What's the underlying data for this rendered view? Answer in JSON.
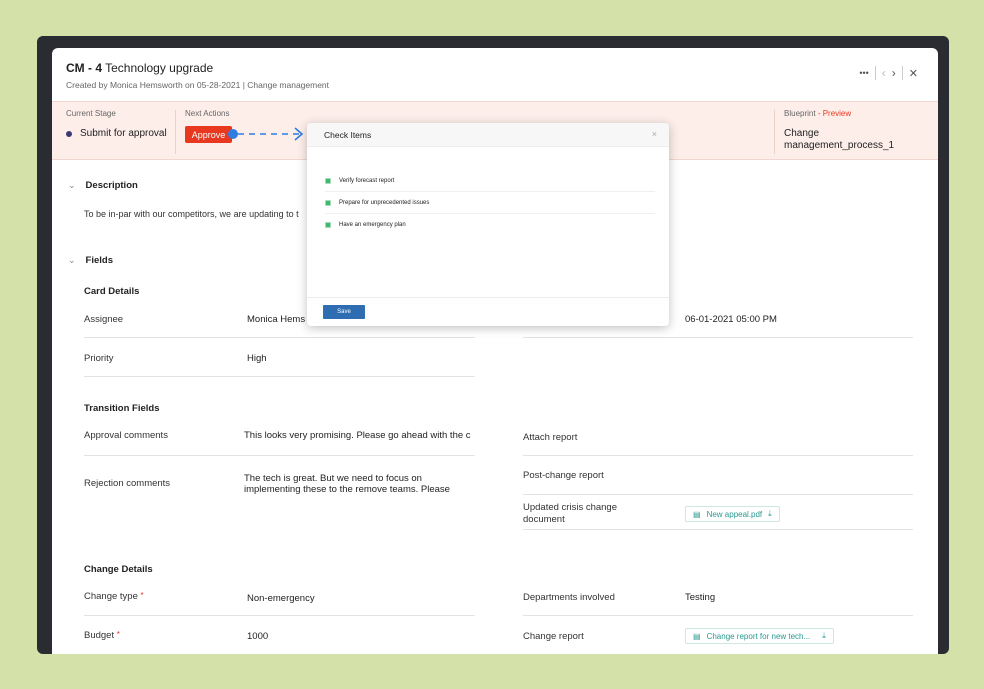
{
  "header": {
    "id": "CM - 4",
    "title": "Technology upgrade",
    "subtitle": "Created by Monica Hemsworth on 05-28-2021 | Change management",
    "more": "•••",
    "prev": "‹",
    "next": "›",
    "close": "✕"
  },
  "stage": {
    "current_label": "Current Stage",
    "current_value": "Submit for approval",
    "next_label": "Next Actions",
    "approve": "Approve",
    "blueprint_label": "Blueprint",
    "blueprint_preview": "- Preview",
    "blueprint_value": "Change management_process_1"
  },
  "description": {
    "heading": "Description",
    "text": "To be in-par with our competitors, we are updating to t"
  },
  "fields": {
    "heading": "Fields",
    "card_details": "Card Details",
    "assignee_label": "Assignee",
    "assignee_value": "Monica Hems",
    "due_value": "06-01-2021 05:00 PM",
    "priority_label": "Priority",
    "priority_value": "High",
    "transition_fields": "Transition Fields",
    "approval_label": "Approval comments",
    "approval_value": "This looks very promising. Please go ahead with the c",
    "rejection_label": "Rejection comments",
    "rejection_value": "The tech is great. But we need to focus on implementing these to the remove teams. Please",
    "attach_label": "Attach report",
    "post_change_label": "Post-change report",
    "crisis_label": "Updated crisis change document",
    "crisis_file": "New appeal.pdf",
    "change_details": "Change Details",
    "change_type_label": "Change type",
    "change_type_value": "Non-emergency",
    "departments_label": "Departments involved",
    "departments_value": "Testing",
    "budget_label": "Budget",
    "budget_value": "1000",
    "change_report_label": "Change report",
    "change_report_file": "Change report for new tech...",
    "required_mark": "*"
  },
  "dialog": {
    "title": "Check Items",
    "close": "×",
    "items": [
      "Verify forecast report",
      "Prepare for unprecedented issues",
      "Have an emergency plan"
    ],
    "save": "Save"
  },
  "colors": {
    "background": "#d4e2a9",
    "accent_red": "#e8381f",
    "save_blue": "#2f6db3",
    "check_green": "#3fb96b",
    "flow_blue": "#2f7de1"
  }
}
